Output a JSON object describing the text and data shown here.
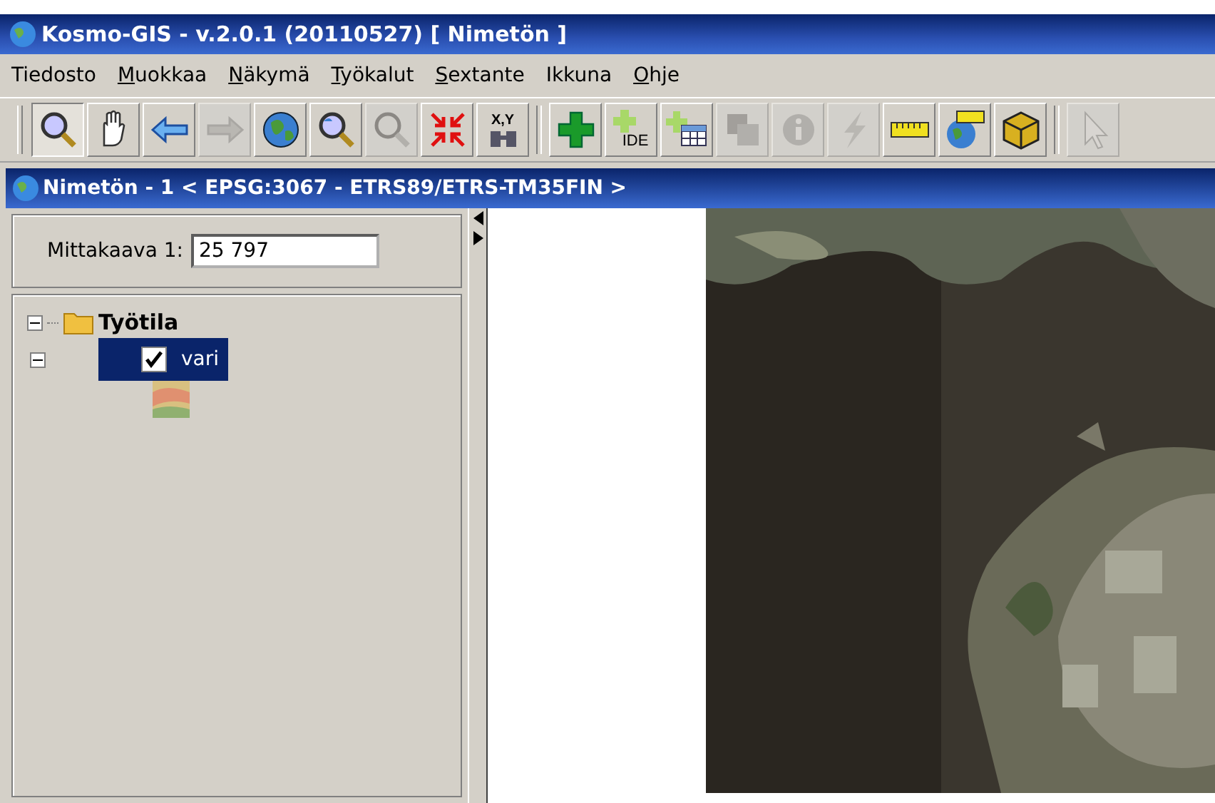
{
  "window": {
    "title": "Kosmo-GIS - v.2.0.1 (20110527)  [ Nimetön ]"
  },
  "menu": [
    {
      "label": "Tiedosto",
      "first_letter_underlined": false
    },
    {
      "label": "Muokkaa",
      "first_letter_underlined": true
    },
    {
      "label": "Näkymä",
      "first_letter_underlined": true
    },
    {
      "label": "Työkalut",
      "first_letter_underlined": true
    },
    {
      "label": "Sextante",
      "first_letter_underlined": true
    },
    {
      "label": "Ikkuna",
      "first_letter_underlined": false
    },
    {
      "label": "Ohje",
      "first_letter_underlined": true
    }
  ],
  "toolbar": [
    {
      "kind": "zoom",
      "selected": true,
      "disabled": false
    },
    {
      "kind": "hand",
      "selected": false,
      "disabled": false
    },
    {
      "kind": "back",
      "selected": false,
      "disabled": false
    },
    {
      "kind": "forward",
      "selected": false,
      "disabled": true
    },
    {
      "kind": "globe",
      "selected": false,
      "disabled": false
    },
    {
      "kind": "zoomglobe",
      "selected": false,
      "disabled": false
    },
    {
      "kind": "zoom",
      "selected": false,
      "disabled": true
    },
    {
      "kind": "shrink",
      "selected": false,
      "disabled": false
    },
    {
      "kind": "xy",
      "label": "X,Y",
      "selected": false,
      "disabled": false
    },
    {
      "kind": "sep"
    },
    {
      "kind": "plus",
      "selected": false,
      "disabled": false
    },
    {
      "kind": "plustext",
      "label": "IDE",
      "selected": false,
      "disabled": false
    },
    {
      "kind": "plustable",
      "selected": false,
      "disabled": false
    },
    {
      "kind": "layers",
      "selected": false,
      "disabled": true
    },
    {
      "kind": "info",
      "selected": false,
      "disabled": true
    },
    {
      "kind": "bolt",
      "selected": false,
      "disabled": true
    },
    {
      "kind": "ruler",
      "selected": false,
      "disabled": false
    },
    {
      "kind": "globeruler",
      "selected": false,
      "disabled": false
    },
    {
      "kind": "box",
      "selected": false,
      "disabled": false
    },
    {
      "kind": "sep"
    },
    {
      "kind": "pointer",
      "selected": false,
      "disabled": true
    }
  ],
  "view": {
    "title": "Nimetön - 1 < EPSG:3067 - ETRS89/ETRS-TM35FIN >",
    "scale_label": "Mittakaava 1:",
    "scale_value": "25 797",
    "tree": [
      {
        "label": "Työtila",
        "expanded": true,
        "children": [
          {
            "label": "vari",
            "checked": true,
            "selected": true,
            "expanded": true
          }
        ]
      }
    ]
  }
}
